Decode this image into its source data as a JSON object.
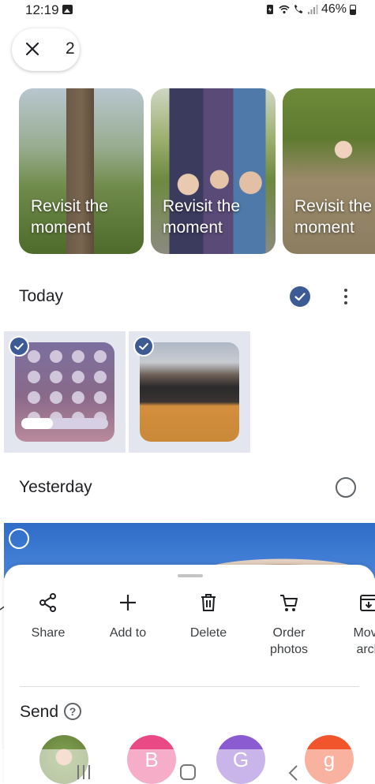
{
  "status_bar": {
    "time": "12:19",
    "battery": "46%",
    "icons": [
      "image-icon",
      "battery-saver-icon",
      "wifi-icon",
      "wifi-calling-icon",
      "signal-icon",
      "battery-icon"
    ]
  },
  "selection": {
    "count": "2",
    "close_icon": "close-icon"
  },
  "memories": [
    {
      "label": "Revisit the\nmoment"
    },
    {
      "label": "Revisit the\nmoment"
    },
    {
      "label": "Revisit the\nmoment"
    }
  ],
  "sections": {
    "today": {
      "title": "Today",
      "selected": true
    },
    "yesterday": {
      "title": "Yesterday",
      "selected": false
    }
  },
  "thumbnails": [
    {
      "selected": true,
      "kind": "screenshot-quick-settings"
    },
    {
      "selected": true,
      "kind": "photo"
    }
  ],
  "sheet": {
    "actions": [
      {
        "label": "Share",
        "icon": "share-icon"
      },
      {
        "label": "Add to",
        "icon": "plus-icon"
      },
      {
        "label": "Delete",
        "icon": "trash-icon"
      },
      {
        "label": "Order\nphotos",
        "icon": "cart-icon"
      },
      {
        "label": "Move\narch",
        "icon": "archive-icon"
      }
    ],
    "send_title": "Send",
    "contacts": [
      {
        "initial": ""
      },
      {
        "initial": "B"
      },
      {
        "initial": "G"
      },
      {
        "initial": "g"
      }
    ]
  },
  "colors": {
    "accent": "#3c5a94",
    "selection_bg": "#e4e6ef"
  }
}
